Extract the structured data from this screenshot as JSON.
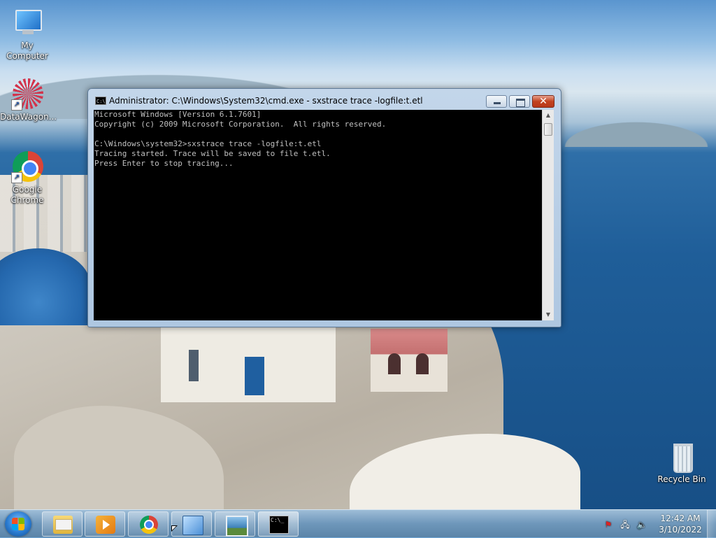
{
  "desktop": {
    "icons": [
      {
        "label": "My Computer",
        "icon": "computer-icon"
      },
      {
        "label": "DataWagon...",
        "icon": "datawagon-icon"
      },
      {
        "label": "Google Chrome",
        "icon": "chrome-icon"
      },
      {
        "label": "Recycle Bin",
        "icon": "recycle-bin-icon"
      }
    ]
  },
  "window": {
    "title": "Administrator: C:\\Windows\\System32\\cmd.exe - sxstrace  trace -logfile:t.etl",
    "icon": "cmd-icon",
    "console_lines": [
      "Microsoft Windows [Version 6.1.7601]",
      "Copyright (c) 2009 Microsoft Corporation.  All rights reserved.",
      "",
      "C:\\Windows\\system32>sxstrace trace -logfile:t.etl",
      "Tracing started. Trace will be saved to file t.etl.",
      "Press Enter to stop tracing..."
    ],
    "controls": {
      "minimize": "minimize-icon",
      "maximize": "maximize-icon",
      "close": "✕"
    }
  },
  "taskbar": {
    "start": "windows-start-icon",
    "buttons": [
      {
        "app": "Windows Explorer",
        "icon": "folder-icon"
      },
      {
        "app": "Windows Media Player",
        "icon": "media-player-icon"
      },
      {
        "app": "Google Chrome",
        "icon": "chrome-icon"
      },
      {
        "app": "Control Panel",
        "icon": "control-panel-icon"
      },
      {
        "app": "Pictures",
        "icon": "picture-icon"
      },
      {
        "app": "Command Prompt",
        "icon": "cmd-icon"
      }
    ],
    "tray_icons": [
      "action-center-flag-icon",
      "network-icon",
      "volume-icon"
    ],
    "clock": {
      "time": "12:42 AM",
      "date": "3/10/2022"
    }
  },
  "colors": {
    "console_bg": "#000000",
    "console_text": "#c0c0c0",
    "close_button": "#c2421f",
    "window_frame": "#aec7e1"
  }
}
